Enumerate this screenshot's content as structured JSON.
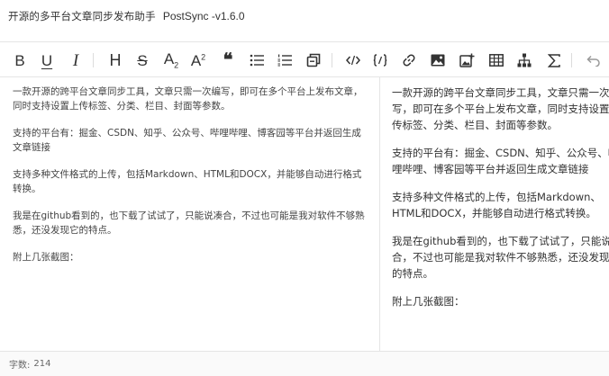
{
  "window": {
    "title_cn": "开源的多平台文章同步发布助手",
    "title_en": "PostSync -v1.6.0"
  },
  "toolbar": {
    "buttons": [
      {
        "id": "bold",
        "icon": "bold-icon",
        "glyph": "B"
      },
      {
        "id": "underline",
        "icon": "underline-icon",
        "glyph": "U"
      },
      {
        "id": "italic",
        "icon": "italic-icon",
        "glyph": "I"
      },
      {
        "id": "heading",
        "icon": "heading-icon",
        "glyph": "H"
      },
      {
        "id": "strikethrough",
        "icon": "strikethrough-icon",
        "glyph": "S"
      },
      {
        "id": "subscript",
        "icon": "subscript-icon",
        "glyph": "A",
        "sub": "2"
      },
      {
        "id": "superscript",
        "icon": "superscript-icon",
        "glyph": "A",
        "sup": "2"
      },
      {
        "id": "quote",
        "icon": "quote-icon",
        "glyph": "❝"
      },
      {
        "id": "unordered-list",
        "icon": "unordered-list-icon"
      },
      {
        "id": "ordered-list",
        "icon": "ordered-list-icon"
      },
      {
        "id": "code-block",
        "icon": "code-block-icon"
      },
      {
        "id": "inline-code",
        "icon": "inline-code-icon"
      },
      {
        "id": "code-brackets",
        "icon": "code-brackets-icon"
      },
      {
        "id": "link",
        "icon": "link-icon"
      },
      {
        "id": "image",
        "icon": "image-icon"
      },
      {
        "id": "add-image",
        "icon": "add-image-icon"
      },
      {
        "id": "table",
        "icon": "table-icon"
      },
      {
        "id": "diagram",
        "icon": "diagram-icon"
      },
      {
        "id": "formula",
        "icon": "sigma-icon"
      },
      {
        "id": "undo",
        "icon": "undo-icon"
      }
    ]
  },
  "editor": {
    "paragraphs": [
      "一款开源的跨平台文章同步工具，文章只需一次编写，即可在多个平台上发布文章，同时支持设置上传标签、分类、栏目、封面等参数。",
      "支持的平台有：掘金、CSDN、知乎、公众号、哔哩哔哩、博客园等平台并返回生成文章链接",
      "支持多种文件格式的上传，包括Markdown、HTML和DOCX，并能够自动进行格式转换。",
      "我是在github看到的，也下载了试试了，只能说凑合，不过也可能是我对软件不够熟悉，还没发现它的特点。",
      "附上几张截图："
    ]
  },
  "preview": {
    "paragraphs": [
      "一款开源的跨平台文章同步工具，文章只需一次编写，即可在多个平台上发布文章，同时支持设置上传标签、分类、栏目、封面等参数。",
      "支持的平台有：掘金、CSDN、知乎、公众号、哔哩哔哩、博客园等平台并返回生成文章链接",
      "支持多种文件格式的上传，包括Markdown、HTML和DOCX，并能够自动进行格式转换。",
      "我是在github看到的，也下载了试试了，只能说凑合，不过也可能是我对软件不够熟悉，还没发现它的特点。",
      "附上几张截图："
    ]
  },
  "status": {
    "word_count_label": "字数:",
    "word_count": "214"
  }
}
